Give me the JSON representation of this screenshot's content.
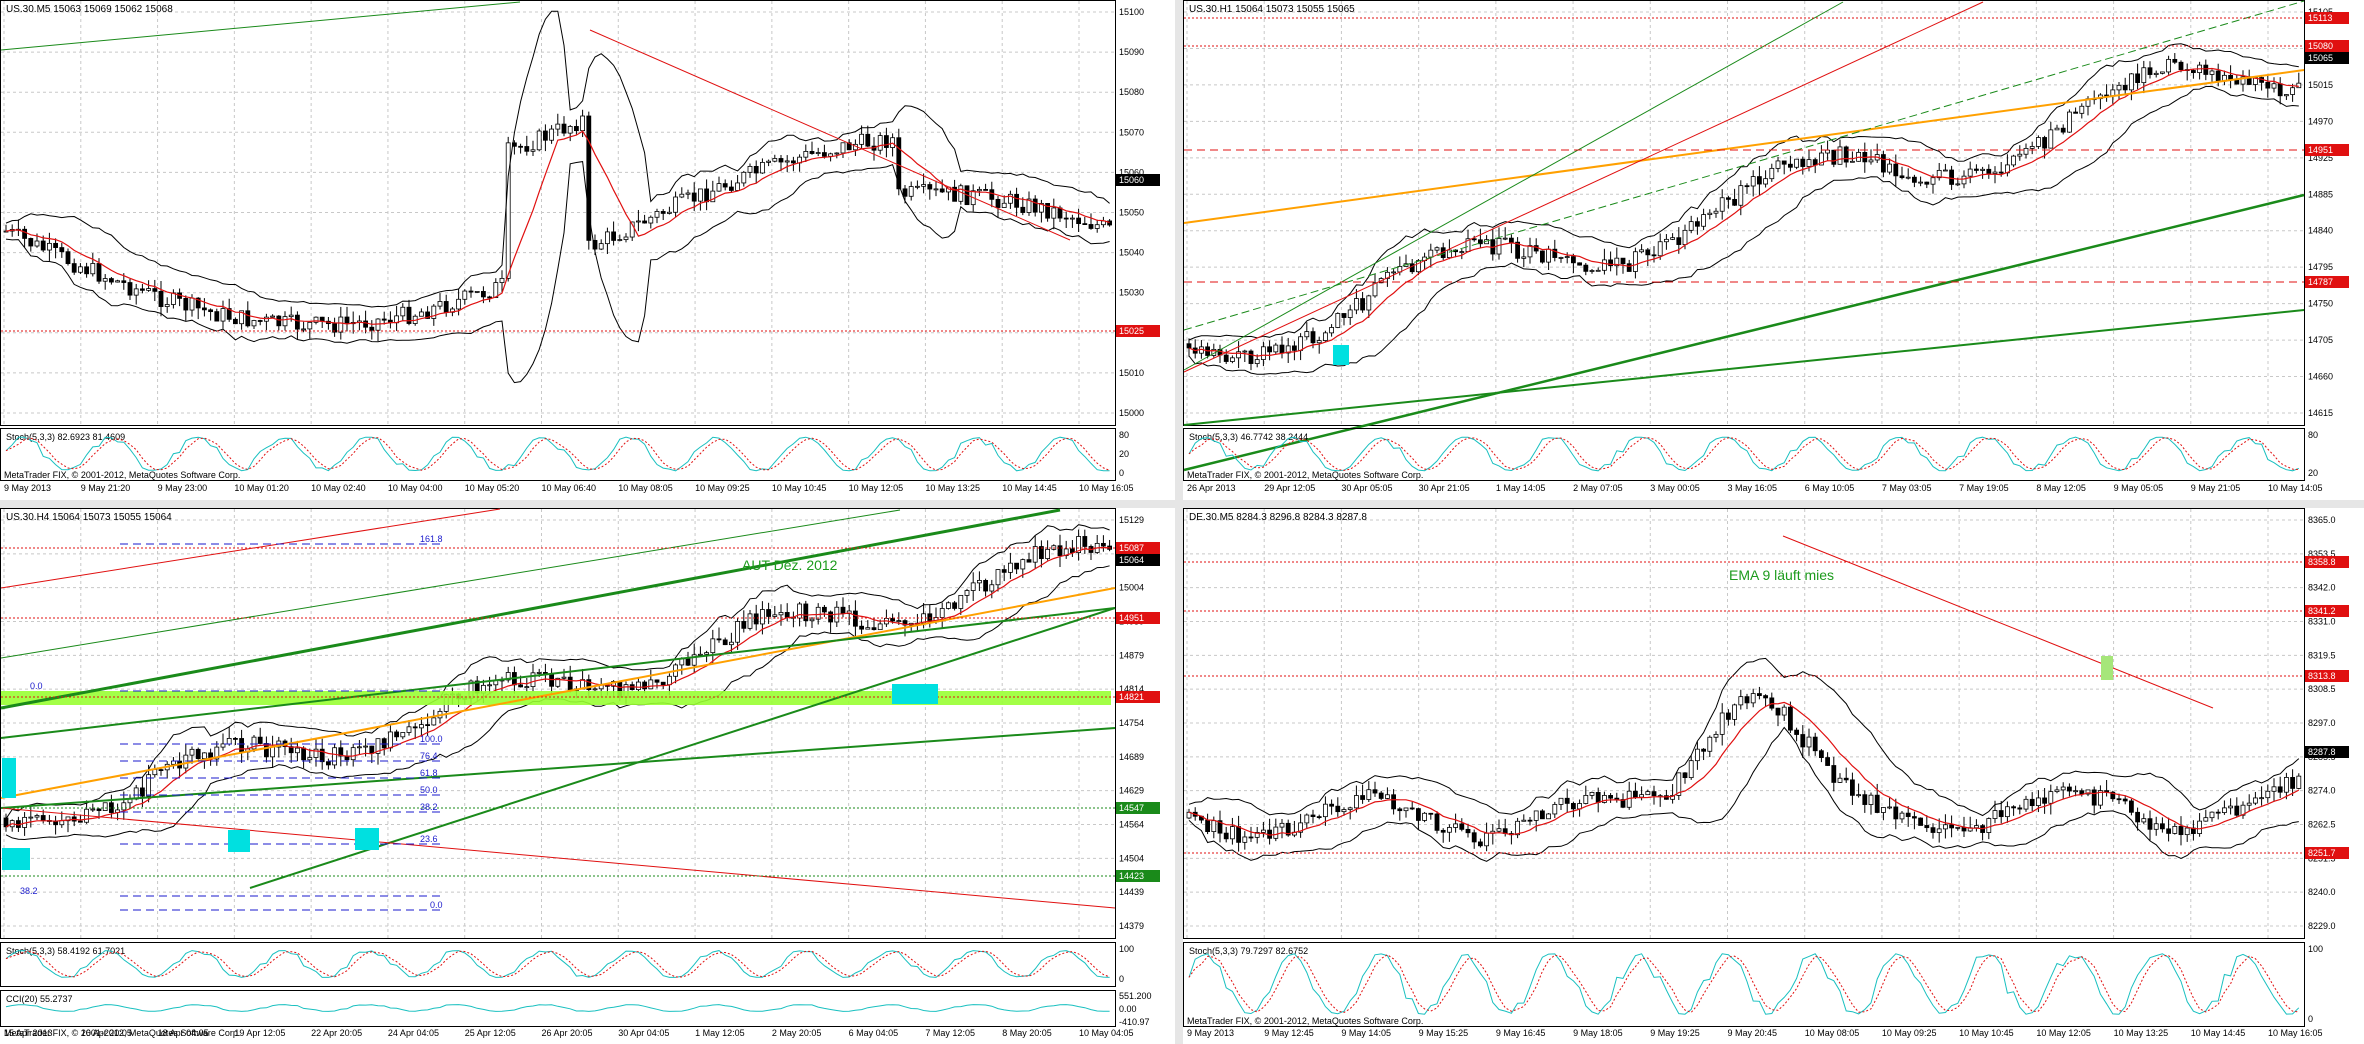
{
  "colors": {
    "background": "#ffffff",
    "grid": "#c8c8c8",
    "candle_up": "#000000",
    "candle_down": "#000000",
    "ma": "#e01010",
    "bands": "#000000",
    "stoch_main": "#19c0c0",
    "stoch_signal": "#e01010",
    "red_level": "#e01010",
    "green_trend": "#1a8a1a",
    "orange_trend": "#ffa000",
    "blue_fib": "#1a1acc",
    "cyan_box": "#00e0e0",
    "lime_zone": "#99ff33",
    "current_price": "#000000"
  },
  "panes": [
    {
      "id": "us30-m5",
      "title": "US.30.M5  15063 15069 15062 15068",
      "copyright": "MetaTrader FIX, © 2001-2012, MetaQuotes Software Corp.",
      "price_ticks": [
        "15100",
        "15090",
        "15080",
        "15070",
        "15060",
        "15050",
        "15040",
        "15030",
        "15020",
        "15010",
        "15000"
      ],
      "price_badges": [
        {
          "label": "15060",
          "type": "current"
        },
        {
          "label": "15025",
          "type": "red"
        }
      ],
      "indicator_label": "Stoch(5,3,3) 82.6923 81.4609",
      "indicator_scale": [
        "80",
        "20",
        "0"
      ],
      "time_ticks": [
        "9 May 2013",
        "9 May 21:20",
        "9 May 23:00",
        "10 May 01:20",
        "10 May 02:40",
        "10 May 04:00",
        "10 May 05:20",
        "10 May 06:40",
        "10 May 08:05",
        "10 May 09:25",
        "10 May 10:45",
        "10 May 12:05",
        "10 May 13:25",
        "10 May 14:45",
        "10 May 16:05"
      ],
      "annotations": []
    },
    {
      "id": "us30-h1",
      "title": "US.30.H1  15064 15073 15055 15065",
      "copyright": "MetaTrader FIX, © 2001-2012, MetaQuotes Software Corp.",
      "price_ticks": [
        "15105",
        "15060",
        "15015",
        "14970",
        "14925",
        "14885",
        "14840",
        "14795",
        "14750",
        "14705",
        "14660",
        "14615"
      ],
      "price_badges": [
        {
          "label": "15113",
          "type": "red"
        },
        {
          "label": "15080",
          "type": "red"
        },
        {
          "label": "15065",
          "type": "current"
        },
        {
          "label": "14951",
          "type": "red"
        },
        {
          "label": "14787",
          "type": "red"
        }
      ],
      "indicator_label": "Stoch(5,3,3) 46.7742 38.2444",
      "indicator_scale": [
        "80",
        "20"
      ],
      "time_ticks": [
        "26 Apr 2013",
        "29 Apr 12:05",
        "30 Apr 05:05",
        "30 Apr 21:05",
        "1 May 14:05",
        "2 May 07:05",
        "3 May 00:05",
        "3 May 16:05",
        "6 May 10:05",
        "7 May 03:05",
        "7 May 19:05",
        "8 May 12:05",
        "9 May 05:05",
        "9 May 21:05",
        "10 May 14:05"
      ],
      "annotations": []
    },
    {
      "id": "us30-h4",
      "title": "US.30.H4  15064 15073 15055 15064",
      "copyright": "MetaTrader FIX, © 2001-2012, MetaQuotes Software Corp.",
      "price_ticks": [
        "15129",
        "15064",
        "15004",
        "14939",
        "14879",
        "14814",
        "14754",
        "14689",
        "14629",
        "14564",
        "14504",
        "14439",
        "14379"
      ],
      "price_badges": [
        {
          "label": "15087",
          "type": "red"
        },
        {
          "label": "15064",
          "type": "current"
        },
        {
          "label": "14951",
          "type": "red"
        },
        {
          "label": "14821",
          "type": "red"
        },
        {
          "label": "14547",
          "type": "green"
        },
        {
          "label": "14423",
          "type": "green"
        }
      ],
      "fib_labels": [
        "161.8",
        "0.0",
        "100.0",
        "76.4",
        "61.8",
        "50.0",
        "38.2",
        "23.6",
        "0.0",
        "38.2"
      ],
      "indicator_label": "Stoch(5,3,3) 58.4192 61.7021",
      "indicator_scale": [
        "100",
        "0"
      ],
      "indicator2_label": "CCI(20) 55.2737",
      "indicator2_scale": [
        "551.200",
        "0.00",
        "-410.97"
      ],
      "time_ticks": [
        "15 Apr 2013",
        "16 Apr 20:05",
        "18 Apr 04:05",
        "19 Apr 12:05",
        "22 Apr 20:05",
        "24 Apr 04:05",
        "25 Apr 12:05",
        "26 Apr 20:05",
        "30 Apr 04:05",
        "1 May 12:05",
        "2 May 20:05",
        "6 May 04:05",
        "7 May 12:05",
        "8 May 20:05",
        "10 May 04:05"
      ],
      "annotations": [
        "AUT Dez. 2012"
      ]
    },
    {
      "id": "de30-m5",
      "title": "DE.30.M5  8284.3 8296.8 8284.3 8287.8",
      "copyright": "MetaTrader FIX, © 2001-2012, MetaQuotes Software Corp.",
      "price_ticks": [
        "8365.0",
        "8353.5",
        "8342.0",
        "8331.0",
        "8319.5",
        "8308.5",
        "8297.0",
        "8285.5",
        "8274.0",
        "8262.5",
        "8251.5",
        "8240.0",
        "8229.0"
      ],
      "price_badges": [
        {
          "label": "8358.8",
          "type": "red"
        },
        {
          "label": "8341.2",
          "type": "red"
        },
        {
          "label": "8313.8",
          "type": "red"
        },
        {
          "label": "8287.8",
          "type": "current"
        },
        {
          "label": "8251.7",
          "type": "red"
        }
      ],
      "indicator_label": "Stoch(5,3,3) 79.7297 82.6752",
      "indicator_scale": [
        "100",
        "0"
      ],
      "time_ticks": [
        "9 May 2013",
        "9 May 12:45",
        "9 May 14:05",
        "9 May 15:25",
        "9 May 16:45",
        "9 May 18:05",
        "9 May 19:25",
        "9 May 20:45",
        "10 May 08:05",
        "10 May 09:25",
        "10 May 10:45",
        "10 May 12:05",
        "10 May 13:25",
        "10 May 14:45",
        "10 May 16:05"
      ],
      "annotations": [
        "EMA 9 läuft mies"
      ]
    }
  ]
}
